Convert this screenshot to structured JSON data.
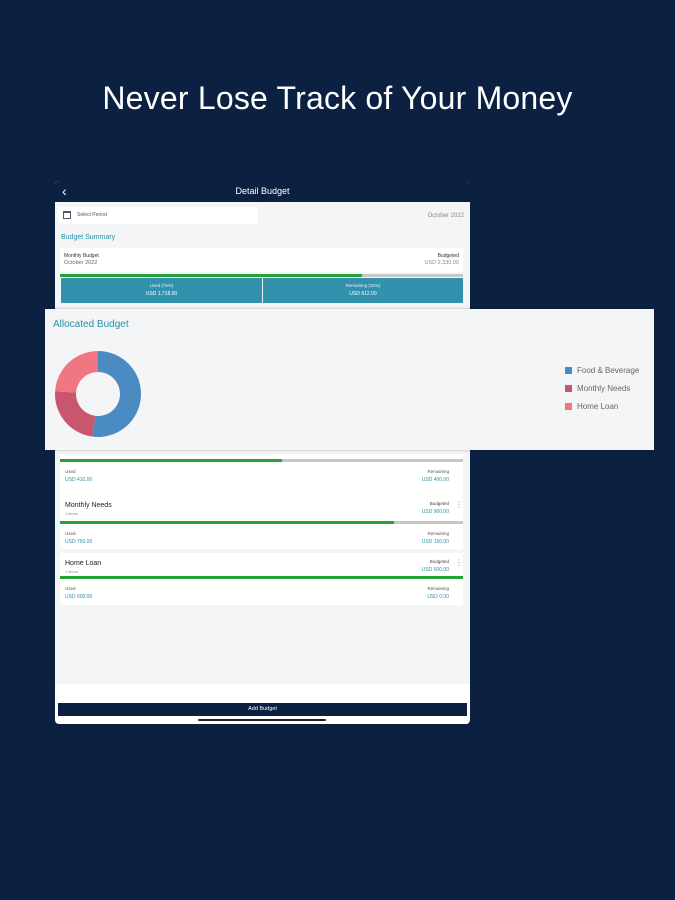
{
  "headline": "Never Lose Track of Your Money",
  "nav": {
    "back": "‹",
    "title": "Detail Budget"
  },
  "period": {
    "label": "Select Period",
    "value": "October 2022"
  },
  "summary": {
    "title": "Budget Summary",
    "monthly_label": "Monthly Budget",
    "monthly_period": "October 2022",
    "budgeted_label": "Budgeted",
    "budgeted_value": "USD 2,330.00",
    "progress": 0.75,
    "used_label": "Used (75%)",
    "used_value": "USD 1,718.00",
    "remaining_label": "Remaining (25%)",
    "remaining_value": "USD 612.00"
  },
  "allocated": {
    "title": "Allocated Budget",
    "legend": [
      {
        "label": "Food & Beverage",
        "color": "#4a8bc2"
      },
      {
        "label": "Monthly Needs",
        "color": "#c8566e"
      },
      {
        "label": "Home Loan",
        "color": "#f07682"
      }
    ]
  },
  "chart_data": {
    "type": "pie",
    "categories": [
      "Food & Beverage",
      "Monthly Needs",
      "Home Loan"
    ],
    "values": [
      52,
      24,
      24
    ],
    "colors": [
      "#4a8bc2",
      "#c8566e",
      "#f07682"
    ],
    "title": "Allocated Budget",
    "donut": true,
    "legend": "right"
  },
  "items": [
    {
      "used_label": "Used",
      "used_value": "USD 410.00",
      "remaining_label": "Remaining",
      "remaining_value": "USD 400.00",
      "progress": 0.55
    },
    {
      "name": "Monthly Needs",
      "sub": "1 items",
      "budgeted_label": "Budgeted",
      "budgeted_value": "USD 900.00",
      "progress": 0.83,
      "used_label": "Used",
      "used_value": "USD 750.00",
      "remaining_label": "Remaining",
      "remaining_value": "USD 150.00"
    },
    {
      "name": "Home Loan",
      "sub": "1 items",
      "budgeted_label": "Budgeted",
      "budgeted_value": "USD 600.00",
      "progress": 1.0,
      "used_label": "Used",
      "used_value": "USD 600.00",
      "remaining_label": "Remaining",
      "remaining_value": "USD 0.00"
    }
  ],
  "add_button": "Add Budget"
}
